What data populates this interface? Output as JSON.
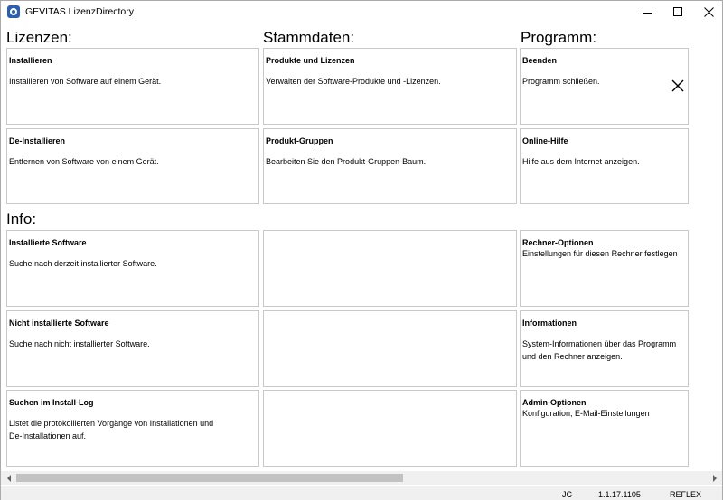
{
  "window": {
    "title": "GEVITAS LizenzDirectory"
  },
  "sections": {
    "lizenzen": "Lizenzen:",
    "stammdaten": "Stammdaten:",
    "programm": "Programm:",
    "info": "Info:"
  },
  "tiles": {
    "installieren": {
      "title": "Installieren",
      "desc": "Installieren von Software auf einem Gerät."
    },
    "deinstallieren": {
      "title": "De-Installieren",
      "desc": "Entfernen von Software von einem Gerät."
    },
    "produkte": {
      "title": "Produkte und Lizenzen",
      "desc": "Verwalten der Software-Produkte und -Lizenzen."
    },
    "gruppen": {
      "title": "Produkt-Gruppen",
      "desc": "Bearbeiten Sie den Produkt-Gruppen-Baum."
    },
    "beenden": {
      "title": "Beenden",
      "desc": "Programm schließen."
    },
    "hilfe": {
      "title": "Online-Hilfe",
      "desc": "Hilfe aus dem Internet anzeigen."
    },
    "installierte": {
      "title": "Installierte Software",
      "desc": "Suche nach derzeit installierter Software."
    },
    "nicht_installierte": {
      "title": "Nicht installierte Software",
      "desc": "Suche nach nicht installierter Software."
    },
    "install_log": {
      "title": "Suchen im Install-Log",
      "desc_line1": "Listet die protokollierten Vorgänge von Installationen und",
      "desc_line2": "De-Installationen auf."
    },
    "rechner": {
      "title": "Rechner-Optionen",
      "desc": "Einstellungen für diesen Rechner festlegen"
    },
    "informationen": {
      "title": "Informationen",
      "desc_line1": "System-Informationen über das Programm",
      "desc_line2": "und den Rechner anzeigen."
    },
    "admin": {
      "title": "Admin-Optionen",
      "desc": "Konfiguration, E-Mail-Einstellungen"
    }
  },
  "status": {
    "user": "JC",
    "version": "1.1.17.1105",
    "server": "REFLEX"
  },
  "scrollbar": {
    "thumb_fraction": 0.56
  },
  "icons": {
    "app": "gevitas-app-icon",
    "minimize": "minimize-icon",
    "maximize": "maximize-icon",
    "close": "close-icon",
    "beenden": "close-x-icon"
  },
  "colors": {
    "app_icon": "#2b5fb4",
    "tile_border": "#c9c9c9",
    "scrollbar_bg": "#f0f0f0"
  }
}
